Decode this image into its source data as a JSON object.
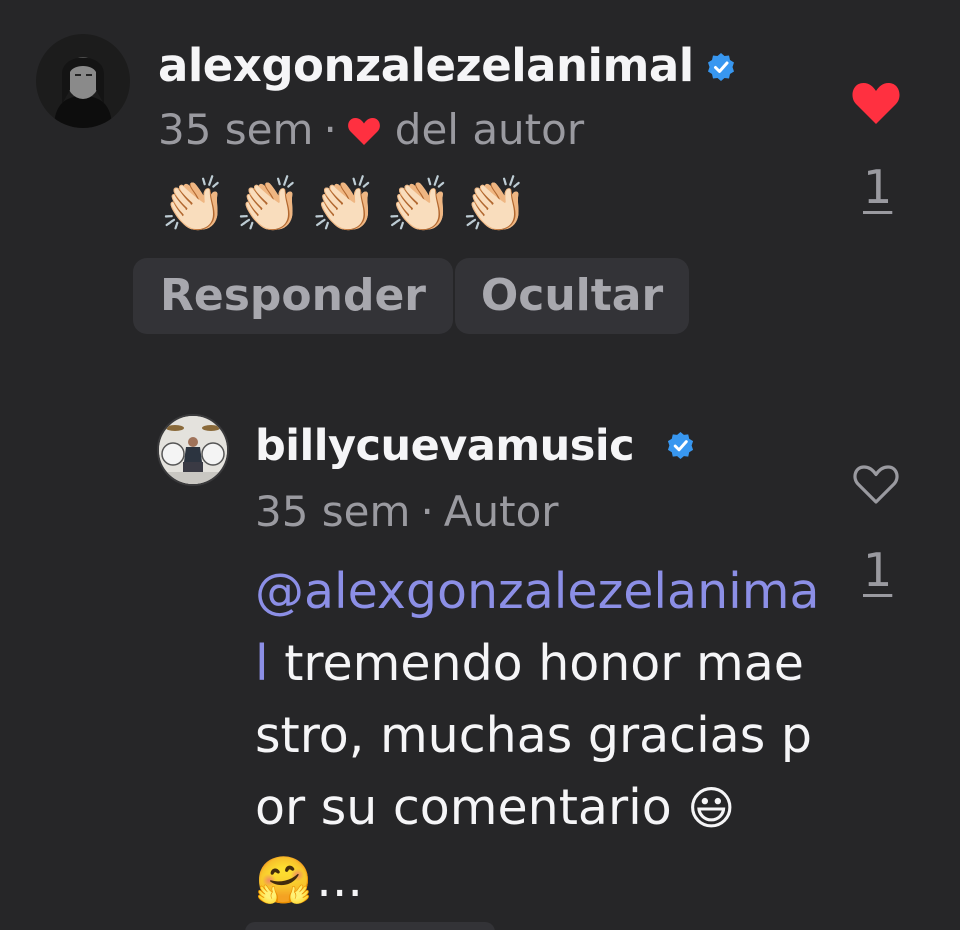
{
  "comment": {
    "username": "alexgonzalezelanimal",
    "time": "35 sem",
    "separator": "·",
    "liked_by_author_label": "del autor",
    "body_emoji": "👏🏻👏🏻👏🏻👏🏻👏🏻",
    "reply_label": "Responder",
    "hide_label": "Ocultar",
    "like_count": "1",
    "like_state": "liked",
    "heart_color": "#ff3040"
  },
  "reply": {
    "username": "billycuevamusic",
    "time": "35 sem",
    "separator": "·",
    "author_badge": "Autor",
    "mention": "@alexgonzalezelanimal",
    "text": " tremendo honor maestro, muchas gracias por su comentario ",
    "trailing_emoji": "😃🤗",
    "ellipsis": "...",
    "like_count": "1",
    "like_state": "not-liked"
  },
  "colors": {
    "background": "#262628",
    "mention": "#8c8fe6",
    "verified": "#3897f0",
    "pill_bg": "#333337"
  }
}
